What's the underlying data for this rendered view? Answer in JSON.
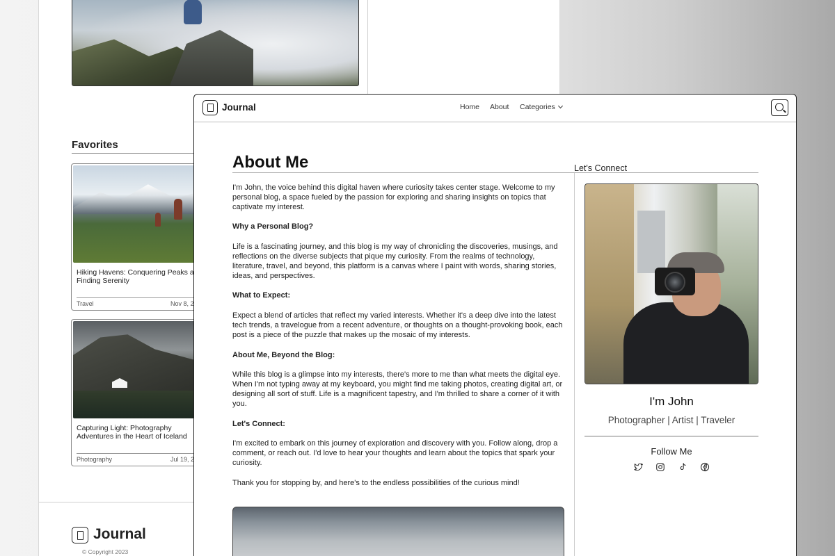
{
  "background_page": {
    "section_title": "Favorites",
    "cards": [
      {
        "title": "Hiking Havens: Conquering Peaks a Finding Serenity",
        "category": "Travel",
        "date": "Nov 8, 2"
      },
      {
        "title": "Capturing Light: Photography Adventures in the Heart of Iceland",
        "category": "Photography",
        "date": "Jul 19, 2"
      }
    ],
    "footer": {
      "logo_text": "Journal",
      "copyright": "© Copyright 2023"
    }
  },
  "nav": {
    "logo_text": "Journal",
    "links": {
      "home": "Home",
      "about": "About",
      "categories": "Categories"
    }
  },
  "main": {
    "title": "About Me",
    "paragraphs": {
      "intro": "I'm John, the voice behind this digital haven where curiosity takes center stage. Welcome to my personal blog, a space fueled by the passion for exploring and sharing insights on topics that captivate my interest.",
      "why_heading": "Why a Personal Blog?",
      "why_text": "Life is a fascinating journey, and this blog is my way of chronicling the discoveries, musings, and reflections on the diverse subjects that pique my curiosity. From the realms of technology, literature, travel, and beyond, this platform is a canvas where I paint with words, sharing stories, ideas, and perspectives.",
      "expect_heading": "What to Expect:",
      "expect_text": "Expect a blend of articles that reflect my varied interests. Whether it's a deep dive into the latest tech trends, a travelogue from a recent adventure, or thoughts on a thought-provoking book, each post is a piece of the puzzle that makes up the mosaic of my interests.",
      "beyond_heading": "About Me, Beyond the Blog:",
      "beyond_text": "While this blog is a glimpse into my interests, there's more to me than what meets the digital eye. When I'm not typing away at my keyboard, you might find me taking photos, creating digital art, or designing all sort of stuff. Life is a magnificent tapestry, and I'm thrilled to share a corner of it with you.",
      "connect_heading": "Let's Connect:",
      "connect_text": "I'm excited to embark on this journey of exploration and discovery with you. Follow along, drop a comment, or reach out. I'd love to hear your thoughts and learn about the topics that spark your curiosity.",
      "closing": "Thank you for stopping by, and here's to the endless possibilities of the curious mind!"
    }
  },
  "sidebar": {
    "title": "Let's Connect",
    "name": "I'm John",
    "roles": "Photographer | Artist | Traveler",
    "follow_label": "Follow Me",
    "socials": [
      "twitter-icon",
      "instagram-icon",
      "tiktok-icon",
      "facebook-icon"
    ]
  }
}
